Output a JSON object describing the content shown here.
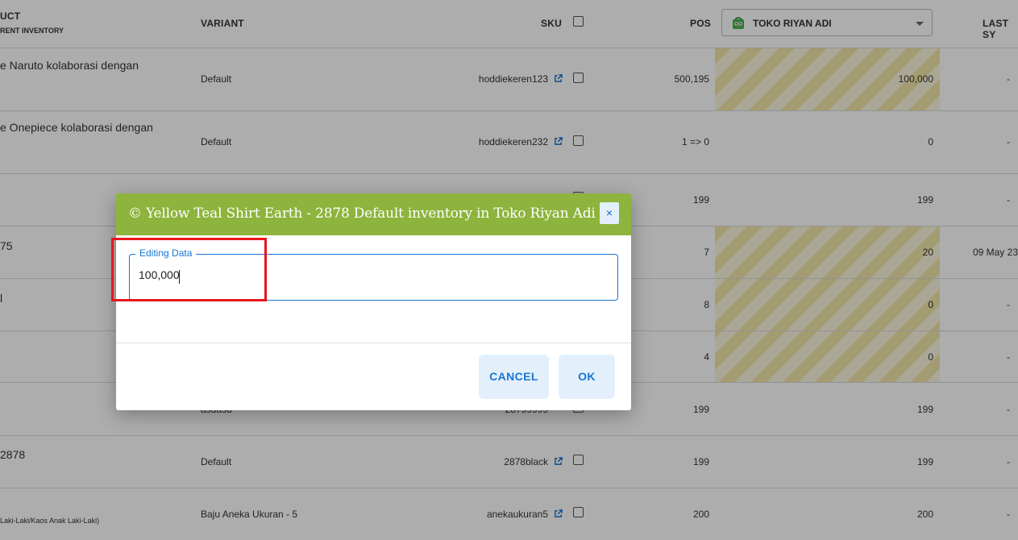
{
  "header": {
    "product": "UCT",
    "product_sub": "RENT INVENTORY",
    "variant": "VARIANT",
    "sku": "SKU",
    "pos": "POS",
    "store": "TOKO RIYAN ADI",
    "last_sync": "LAST SY"
  },
  "rows": [
    {
      "name": "e Naruto kolaborasi dengan",
      "variant": "Default",
      "sku": "hoddiekeren123",
      "pos": "500,195",
      "store_qty": "100,000",
      "last": "-"
    },
    {
      "name": "e Onepiece kolaborasi dengan",
      "variant": "Default",
      "sku": "hoddiekeren232",
      "pos": "1 => 0",
      "store_qty": "0",
      "last": "-"
    },
    {
      "name": "",
      "variant": "",
      "sku": "",
      "pos": "199",
      "store_qty": "199",
      "last": "-"
    },
    {
      "name": "75",
      "variant": "",
      "sku": "",
      "pos": "7",
      "store_qty": "20",
      "last": "09 May 23"
    },
    {
      "name": "l",
      "variant": "",
      "sku": "",
      "pos": "8",
      "store_qty": "0",
      "last": "-"
    },
    {
      "name": "",
      "variant": "",
      "sku": "",
      "pos": "4",
      "store_qty": "0",
      "last": "-"
    },
    {
      "name": "",
      "variant": "asdasd",
      "sku": "28799999",
      "pos": "199",
      "store_qty": "199",
      "last": "-"
    },
    {
      "name": "2878",
      "variant": "Default",
      "sku": "2878black",
      "pos": "199",
      "store_qty": "199",
      "last": "-"
    },
    {
      "name": "Laki-Laki/Kaos Anak Laki-Laki)",
      "variant": "Baju Aneka Ukuran - 5",
      "sku": "anekaukuran5",
      "pos": "200",
      "store_qty": "200",
      "last": "-"
    }
  ],
  "dialog": {
    "title": "© Yellow Teal Shirt Earth - 2878 Default inventory in Toko Riyan Adi",
    "close": "×",
    "field_label": "Editing Data",
    "field_value": "100,000",
    "cancel": "CANCEL",
    "ok": "OK"
  },
  "colors": {
    "dialog_header": "#8db43d",
    "button_bg": "#e3f0fb",
    "accent": "#1976d2",
    "highlight": "#e8161b"
  }
}
